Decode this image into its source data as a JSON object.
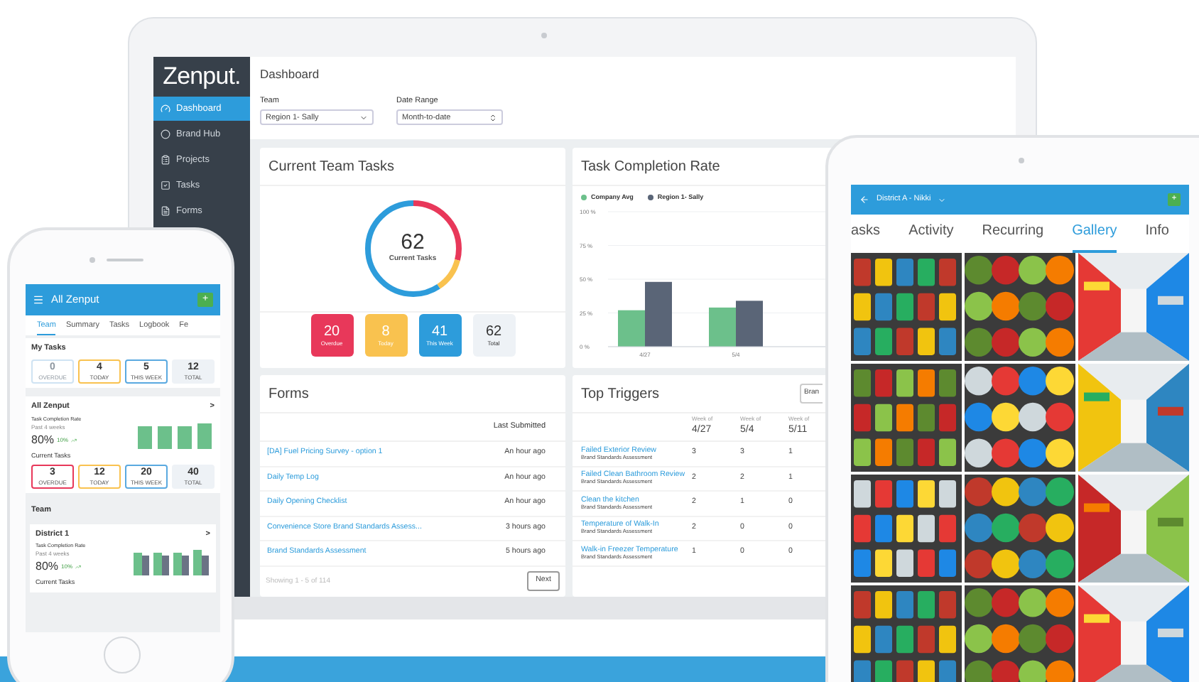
{
  "laptop": {
    "sidebar": {
      "logo": "Zenput.",
      "items": [
        {
          "label": "Dashboard",
          "selected": true
        },
        {
          "label": "Brand Hub",
          "selected": false
        },
        {
          "label": "Projects",
          "selected": false
        },
        {
          "label": "Tasks",
          "selected": false
        },
        {
          "label": "Forms",
          "selected": false
        }
      ]
    },
    "title": "Dashboard",
    "filters": [
      {
        "label": "Team",
        "value": "Region 1- Sally",
        "kind": "dropdown"
      },
      {
        "label": "Date Range",
        "value": "Month-to-date",
        "kind": "stepper"
      }
    ],
    "current_team_tasks": {
      "title": "Current Team Tasks",
      "total": "62",
      "total_label": "Current Tasks",
      "stats": [
        {
          "value": "20",
          "label": "Overdue",
          "color": "#e8385a",
          "kind": "filled"
        },
        {
          "value": "8",
          "label": "Today",
          "color": "#f9c24f",
          "kind": "filled"
        },
        {
          "value": "41",
          "label": "This Week",
          "color": "#2d9cdb",
          "kind": "filled"
        },
        {
          "value": "62",
          "label": "Total",
          "color": "#eef2f6",
          "kind": "plain"
        }
      ]
    },
    "task_completion_rate": {
      "title": "Task Completion Rate",
      "chart_data": {
        "type": "bar",
        "categories": [
          "4/27",
          "5/4"
        ],
        "series": [
          {
            "name": "Company Avg",
            "color": "#6cc08b",
            "values": [
              27,
              29
            ]
          },
          {
            "name": "Region 1- Sally",
            "color": "#5a6577",
            "values": [
              48,
              34
            ]
          }
        ],
        "ylim": [
          0,
          100
        ],
        "grid": true,
        "yticks": [
          {
            "value": 0,
            "label": "0 %"
          },
          {
            "value": 25,
            "label": "25 %"
          },
          {
            "value": 50,
            "label": "50 %"
          },
          {
            "value": 75,
            "label": "75 %"
          },
          {
            "value": 100,
            "label": "100 %"
          }
        ]
      }
    },
    "forms": {
      "title": "Forms",
      "column": "Last Submitted",
      "rows": [
        {
          "name": "[DA] Fuel Pricing Survey - option 1",
          "time": "An hour ago"
        },
        {
          "name": "Daily Temp Log",
          "time": "An hour ago"
        },
        {
          "name": "Daily Opening Checklist",
          "time": "An hour ago"
        },
        {
          "name": "Convenience Store Brand Standards Assess...",
          "time": "3 hours ago"
        },
        {
          "name": "Brand Standards Assessment",
          "time": "5 hours ago"
        }
      ],
      "footer": "Showing 1 - 5 of 114",
      "next": "Next"
    },
    "top_triggers": {
      "title": "Top Triggers",
      "button": "Bran",
      "columns": [
        {
          "caption": "Week of",
          "date": "4/27"
        },
        {
          "caption": "Week of",
          "date": "5/4"
        },
        {
          "caption": "Week of",
          "date": "5/11"
        }
      ],
      "rows": [
        {
          "name": "Failed Exterior Review",
          "form": "Brand Standards Assessment",
          "values": [
            "3",
            "3",
            "1"
          ]
        },
        {
          "name": "Failed Clean Bathroom Review",
          "form": "Brand Standards Assessment",
          "values": [
            "2",
            "2",
            "1"
          ]
        },
        {
          "name": "Clean the kitchen",
          "form": "Brand Standards Assessment",
          "values": [
            "2",
            "1",
            "0"
          ]
        },
        {
          "name": "Temperature of Walk-In",
          "form": "Brand Standards Assessment",
          "values": [
            "2",
            "0",
            "0"
          ]
        },
        {
          "name": "Walk-in Freezer Temperature",
          "form": "Brand Standards Assessment",
          "values": [
            "1",
            "0",
            "0"
          ]
        }
      ]
    }
  },
  "phone": {
    "title": "All Zenput",
    "add": "+",
    "tabs": [
      {
        "label": "Team",
        "selected": true
      },
      {
        "label": "Summary",
        "selected": false
      },
      {
        "label": "Tasks",
        "selected": false
      },
      {
        "label": "Logbook",
        "selected": false
      },
      {
        "label": "Fe",
        "selected": false
      }
    ],
    "my_tasks": {
      "title": "My Tasks",
      "stats": [
        {
          "value": "0",
          "label": "OVERDUE",
          "color": "#cfe3f3",
          "faded": true,
          "kind": "outline"
        },
        {
          "value": "4",
          "label": "TODAY",
          "color": "#f9c24f",
          "faded": false,
          "kind": "outline"
        },
        {
          "value": "5",
          "label": "THIS WEEK",
          "color": "#5aa9e0",
          "faded": false,
          "kind": "outline"
        },
        {
          "value": "12",
          "label": "TOTAL",
          "color": "#eef2f6",
          "faded": false,
          "kind": "filled"
        }
      ]
    },
    "summary": {
      "title": "All Zenput",
      "chevron": ">",
      "rate_title": "Task Completion Rate",
      "rate_period": "Past 4 weeks",
      "rate": "80%",
      "change": "10%",
      "tasks_title": "Current Tasks",
      "stats": [
        {
          "value": "3",
          "label": "OVERDUE",
          "color": "#e8385a",
          "faded": false,
          "kind": "outline"
        },
        {
          "value": "12",
          "label": "TODAY",
          "color": "#f9c24f",
          "faded": false,
          "kind": "outline"
        },
        {
          "value": "20",
          "label": "THIS WEEK",
          "color": "#5aa9e0",
          "faded": false,
          "kind": "outline"
        },
        {
          "value": "40",
          "label": "TOTAL",
          "color": "#eef2f6",
          "faded": false,
          "kind": "filled"
        }
      ]
    },
    "team_heading": "Team",
    "district": {
      "title": "District 1",
      "chevron": ">",
      "rate_title": "Task Completion Rate",
      "rate_period": "Past 4 weeks",
      "rate": "80%",
      "change": "10%",
      "tasks_title": "Current Tasks"
    }
  },
  "tablet": {
    "title": "District A - Nikki",
    "add": "+",
    "tabs": [
      {
        "label": "asks",
        "selected": false
      },
      {
        "label": "Activity",
        "selected": false
      },
      {
        "label": "Recurring",
        "selected": false
      },
      {
        "label": "Gallery",
        "selected": true
      },
      {
        "label": "Info",
        "selected": false
      }
    ]
  }
}
